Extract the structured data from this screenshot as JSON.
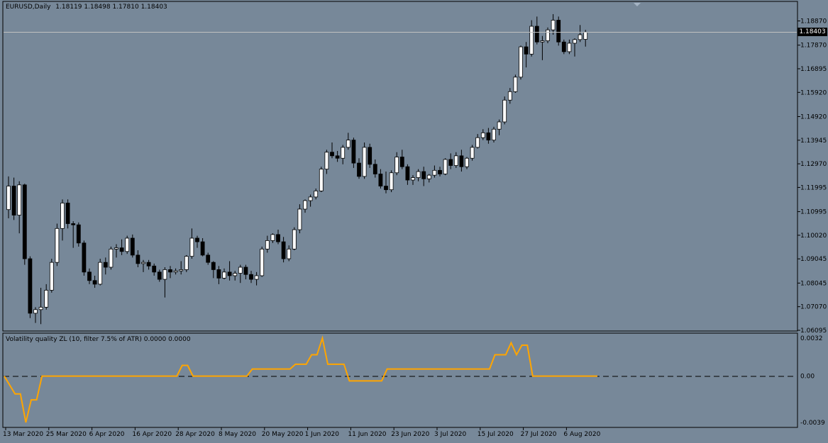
{
  "main_chart": {
    "title": "EURUSD,Daily",
    "ohlc": [
      "1.18119",
      "1.18498",
      "1.17810",
      "1.18403"
    ],
    "current_price_label": "1.18403"
  },
  "indicator": {
    "title": "Volatility quality ZL (10, filter 7.5% of ATR) 0.0000 0.0000",
    "ticks": [
      "0.0032",
      "0.00",
      "-0.0039"
    ]
  },
  "colors": {
    "background": "#778899",
    "bull_candle": "#ffffff",
    "bear_candle": "#000000",
    "indicator_line": "#ffa500",
    "current_price_line": "#c0c0c0"
  },
  "chart_data": [
    {
      "type": "candlestick",
      "title": "EURUSD,Daily",
      "x_labels": [
        "13 Mar 2020",
        "25 Mar 2020",
        "6 Apr 2020",
        "16 Apr 2020",
        "28 Apr 2020",
        "8 May 2020",
        "20 May 2020",
        "1 Jun 2020",
        "11 Jun 2020",
        "23 Jun 2020",
        "3 Jul 2020",
        "15 Jul 2020",
        "27 Jul 2020",
        "6 Aug 2020"
      ],
      "y_ticks": [
        "1.18870",
        "1.17870",
        "1.16895",
        "1.15920",
        "1.14920",
        "1.13945",
        "1.12970",
        "1.11995",
        "1.10995",
        "1.10020",
        "1.09045",
        "1.08045",
        "1.07070",
        "1.06095"
      ],
      "ylim": [
        1.06095,
        1.1952
      ],
      "current_price": 1.18403,
      "candles": [
        [
          1.1108,
          1.1245,
          1.1072,
          1.1205
        ],
        [
          1.1205,
          1.124,
          1.1065,
          1.1085
        ],
        [
          1.1085,
          1.1225,
          1.101,
          1.121
        ],
        [
          1.121,
          1.1215,
          1.088,
          1.0905
        ],
        [
          1.0905,
          1.0915,
          1.066,
          1.068
        ],
        [
          1.068,
          1.0705,
          1.064,
          1.0695
        ],
        [
          1.0695,
          1.0785,
          1.0635,
          1.0705
        ],
        [
          1.0705,
          1.08,
          1.0695,
          1.0775
        ],
        [
          1.0775,
          1.0905,
          1.0765,
          1.089
        ],
        [
          1.089,
          1.105,
          1.0875,
          1.103
        ],
        [
          1.103,
          1.115,
          1.098,
          1.1135
        ],
        [
          1.1135,
          1.115,
          1.103,
          1.105
        ],
        [
          1.105,
          1.106,
          1.095,
          1.1045
        ],
        [
          1.1045,
          1.1055,
          1.0955,
          1.097
        ],
        [
          1.097,
          1.098,
          1.0835,
          1.085
        ],
        [
          1.085,
          1.0865,
          1.08,
          1.0815
        ],
        [
          1.0815,
          1.0835,
          1.0785,
          1.08
        ],
        [
          1.08,
          1.0905,
          1.0795,
          1.089
        ],
        [
          1.089,
          1.091,
          1.084,
          1.087
        ],
        [
          1.087,
          1.0955,
          1.086,
          1.0945
        ],
        [
          1.0945,
          1.0965,
          1.091,
          1.095
        ],
        [
          1.095,
          1.0985,
          1.092,
          1.0935
        ],
        [
          1.0935,
          1.1,
          1.0925,
          1.099
        ],
        [
          1.099,
          1.1005,
          1.091,
          1.092
        ],
        [
          1.092,
          1.094,
          1.087,
          1.0885
        ],
        [
          1.0885,
          1.09,
          1.085,
          1.089
        ],
        [
          1.089,
          1.09,
          1.086,
          1.0875
        ],
        [
          1.0875,
          1.0885,
          1.0835,
          1.085
        ],
        [
          1.085,
          1.086,
          1.081,
          1.082
        ],
        [
          1.082,
          1.087,
          1.0745,
          1.086
        ],
        [
          1.086,
          1.0875,
          1.0825,
          1.085
        ],
        [
          1.085,
          1.0865,
          1.084,
          1.0855
        ],
        [
          1.0855,
          1.0895,
          1.084,
          1.086
        ],
        [
          1.086,
          1.092,
          1.085,
          1.0915
        ],
        [
          1.0915,
          1.103,
          1.0905,
          1.099
        ],
        [
          1.099,
          1.1,
          1.095,
          1.0975
        ],
        [
          1.0975,
          1.099,
          1.0915,
          1.092
        ],
        [
          1.092,
          1.093,
          1.088,
          1.089
        ],
        [
          1.089,
          1.0895,
          1.0825,
          1.086
        ],
        [
          1.086,
          1.0875,
          1.08,
          1.0825
        ],
        [
          1.0825,
          1.0865,
          1.082,
          1.085
        ],
        [
          1.085,
          1.0895,
          1.0815,
          1.0835
        ],
        [
          1.0835,
          1.0855,
          1.0815,
          1.0845
        ],
        [
          1.0845,
          1.088,
          1.0805,
          1.087
        ],
        [
          1.087,
          1.088,
          1.082,
          1.084
        ],
        [
          1.084,
          1.0855,
          1.0805,
          1.082
        ],
        [
          1.082,
          1.085,
          1.0795,
          1.0835
        ],
        [
          1.0835,
          1.0955,
          1.083,
          1.0945
        ],
        [
          1.0945,
          1.1,
          1.093,
          1.098
        ],
        [
          1.098,
          1.101,
          1.097,
          1.1005
        ],
        [
          1.1005,
          1.1025,
          1.0965,
          1.0975
        ],
        [
          1.0975,
          1.0995,
          1.089,
          1.0905
        ],
        [
          1.0905,
          1.096,
          1.0895,
          1.0945
        ],
        [
          1.0945,
          1.1035,
          1.094,
          1.1025
        ],
        [
          1.1025,
          1.113,
          1.101,
          1.111
        ],
        [
          1.111,
          1.115,
          1.1095,
          1.1145
        ],
        [
          1.1145,
          1.117,
          1.112,
          1.116
        ],
        [
          1.116,
          1.1195,
          1.115,
          1.1185
        ],
        [
          1.1185,
          1.1285,
          1.118,
          1.1275
        ],
        [
          1.1275,
          1.1355,
          1.1255,
          1.1345
        ],
        [
          1.1345,
          1.1385,
          1.132,
          1.133
        ],
        [
          1.133,
          1.135,
          1.1305,
          1.132
        ],
        [
          1.132,
          1.1375,
          1.1295,
          1.1365
        ],
        [
          1.1365,
          1.1425,
          1.1355,
          1.1395
        ],
        [
          1.1395,
          1.1405,
          1.128,
          1.13
        ],
        [
          1.13,
          1.132,
          1.1235,
          1.1245
        ],
        [
          1.1245,
          1.1385,
          1.1235,
          1.1365
        ],
        [
          1.1365,
          1.138,
          1.128,
          1.1295
        ],
        [
          1.1295,
          1.1315,
          1.124,
          1.1255
        ],
        [
          1.1255,
          1.1275,
          1.1195,
          1.1205
        ],
        [
          1.1205,
          1.1265,
          1.1175,
          1.119
        ],
        [
          1.119,
          1.127,
          1.118,
          1.126
        ],
        [
          1.126,
          1.1345,
          1.125,
          1.1325
        ],
        [
          1.1325,
          1.1355,
          1.1275,
          1.1285
        ],
        [
          1.1285,
          1.1295,
          1.121,
          1.123
        ],
        [
          1.123,
          1.125,
          1.121,
          1.124
        ],
        [
          1.124,
          1.1275,
          1.1225,
          1.1265
        ],
        [
          1.1265,
          1.1285,
          1.1205,
          1.1235
        ],
        [
          1.1235,
          1.1255,
          1.122,
          1.125
        ],
        [
          1.125,
          1.129,
          1.124,
          1.127
        ],
        [
          1.127,
          1.1285,
          1.1245,
          1.1255
        ],
        [
          1.1255,
          1.132,
          1.125,
          1.1315
        ],
        [
          1.1315,
          1.134,
          1.1275,
          1.129
        ],
        [
          1.129,
          1.1345,
          1.128,
          1.133
        ],
        [
          1.133,
          1.1355,
          1.1265,
          1.1285
        ],
        [
          1.1285,
          1.1325,
          1.1275,
          1.132
        ],
        [
          1.132,
          1.1375,
          1.131,
          1.1365
        ],
        [
          1.1365,
          1.142,
          1.136,
          1.1405
        ],
        [
          1.1405,
          1.144,
          1.1395,
          1.1425
        ],
        [
          1.1425,
          1.1445,
          1.138,
          1.1395
        ],
        [
          1.1395,
          1.145,
          1.1385,
          1.144
        ],
        [
          1.144,
          1.148,
          1.1415,
          1.147
        ],
        [
          1.147,
          1.1575,
          1.146,
          1.156
        ],
        [
          1.156,
          1.161,
          1.1545,
          1.1595
        ],
        [
          1.1595,
          1.1665,
          1.159,
          1.1655
        ],
        [
          1.1655,
          1.1785,
          1.1645,
          1.178
        ],
        [
          1.178,
          1.18,
          1.1695,
          1.175
        ],
        [
          1.175,
          1.189,
          1.174,
          1.1865
        ],
        [
          1.1865,
          1.1905,
          1.179,
          1.18
        ],
        [
          1.18,
          1.1825,
          1.1725,
          1.1805
        ],
        [
          1.1805,
          1.186,
          1.1795,
          1.185
        ],
        [
          1.185,
          1.1915,
          1.183,
          1.189
        ],
        [
          1.189,
          1.1905,
          1.1785,
          1.18
        ],
        [
          1.18,
          1.181,
          1.175,
          1.176
        ],
        [
          1.176,
          1.181,
          1.175,
          1.1795
        ],
        [
          1.1795,
          1.1815,
          1.174,
          1.181
        ],
        [
          1.181,
          1.187,
          1.18,
          1.183
        ],
        [
          1.1811,
          1.185,
          1.1781,
          1.184
        ]
      ]
    },
    {
      "type": "line",
      "title": "Volatility quality ZL (10, filter 7.5% of ATR) 0.0000 0.0000",
      "series": [
        {
          "values": [
            0.0,
            -0.0015,
            -0.0015,
            -0.0039,
            -0.002,
            -0.002,
            0.0,
            0.0,
            0.0,
            0.0,
            0.0,
            0.0,
            0.0,
            0.0,
            0.0,
            0.0,
            0.0,
            0.0,
            0.0,
            0.0,
            0.0,
            0.0,
            0.0,
            0.0,
            0.0,
            0.0,
            0.0,
            0.0,
            0.0,
            0.0,
            0.0,
            0.0,
            0.0,
            0.0,
            0.0,
            0.0,
            0.0,
            0.0,
            0.0,
            0.0,
            0.0,
            0.0,
            0.0,
            0.0,
            0.0,
            0.0,
            0.0,
            0.0,
            0.0,
            0.0,
            0.0,
            0.0,
            0.0,
            0.0,
            0.0,
            0.0,
            0.0,
            0.0,
            0.0,
            0.0,
            0.0,
            0.0,
            0.0,
            0.0,
            0.0,
            0.0,
            0.0,
            0.0,
            0.0,
            0.0,
            0.0,
            0.0,
            0.0,
            0.0,
            0.0,
            0.0,
            0.0,
            0.0,
            0.0,
            0.0,
            0.0,
            0.0,
            0.0,
            0.0,
            0.0,
            0.0,
            0.0,
            0.0,
            0.0,
            0.0,
            0.0,
            0.0,
            0.0,
            0.0,
            0.0,
            0.0,
            0.0,
            0.0,
            0.0,
            0.0,
            0.0,
            0.0,
            0.0,
            0.0,
            0.0,
            0.0,
            0.0,
            0.0,
            0.0,
            0.0,
            0.0,
            0.0
          ]
        }
      ],
      "x_values_day_index": [
        0,
        3,
        4,
        5,
        6,
        7,
        8,
        9,
        10,
        11,
        12,
        13,
        14,
        15,
        16,
        17,
        18,
        19,
        20,
        21,
        22,
        23,
        24,
        25,
        26,
        27,
        28,
        29,
        30,
        31,
        32,
        33,
        34,
        35,
        36,
        37,
        38,
        39,
        40,
        41,
        42,
        43,
        44,
        45,
        46,
        47,
        48,
        49,
        50,
        51,
        52,
        53,
        54,
        55,
        56,
        57,
        58,
        59,
        60,
        61,
        62,
        63,
        64,
        65,
        66,
        67,
        68,
        69,
        70,
        71,
        72,
        73,
        74,
        75,
        76,
        77,
        78,
        79,
        80,
        81,
        82,
        83,
        84,
        85,
        86,
        87,
        88,
        89,
        90,
        91,
        92,
        93,
        94,
        95,
        96,
        97,
        98,
        99,
        100,
        101,
        102,
        103,
        104,
        105,
        106,
        107,
        108,
        109,
        110,
        111,
        112
      ],
      "line_values": [
        0.0,
        -0.0015,
        -0.0015,
        -0.0039,
        -0.002,
        -0.002,
        0.0,
        0.0,
        0.0,
        0.0,
        0.0,
        0.0,
        0.0,
        0.0,
        0.0,
        0.0,
        0.0,
        0.0,
        0.0,
        0.0,
        0.0,
        0.0,
        0.0,
        0.0,
        0.0,
        0.0,
        0.0,
        0.0,
        0.0,
        0.0,
        0.0,
        0.0,
        0.0,
        0.0,
        0.0,
        0.0,
        0.0,
        0.0,
        0.0,
        0.0,
        0.0,
        0.0,
        0.0,
        0.0,
        0.0,
        0.0,
        0.0,
        0.0,
        0.0,
        0.0,
        0.0,
        0.0,
        0.0,
        0.0,
        0.0,
        0.0,
        0.0,
        0.0,
        0.0,
        0.0,
        0.0,
        0.0,
        0.0,
        0.0,
        0.0,
        0.0,
        0.0,
        0.0,
        0.0,
        0.0,
        0.0,
        0.0,
        0.0,
        0.0,
        0.0,
        0.0,
        0.0,
        0.0,
        0.0,
        0.0,
        0.0,
        0.0,
        0.0,
        0.0,
        0.0,
        0.0,
        0.0,
        0.0,
        0.0,
        0.0,
        0.0,
        0.0,
        0.0,
        0.0,
        0.0,
        0.0,
        0.0,
        0.0,
        0.0,
        0.0,
        0.0,
        0.0,
        0.0,
        0.0,
        0.0,
        0.0,
        0.0,
        0.0,
        0.0,
        0.0,
        0.0
      ],
      "steps": [
        [
          0,
          0.0
        ],
        [
          2,
          -0.0015
        ],
        [
          3,
          -0.0015
        ],
        [
          4,
          -0.0039
        ],
        [
          5,
          -0.002
        ],
        [
          6,
          -0.002
        ],
        [
          7,
          0.0
        ],
        [
          32,
          0.0
        ],
        [
          33,
          0.0009
        ],
        [
          34,
          0.0009
        ],
        [
          35,
          0.0
        ],
        [
          44,
          0.0
        ],
        [
          45,
          0.0
        ],
        [
          46,
          0.0006
        ],
        [
          53,
          0.0006
        ],
        [
          54,
          0.001
        ],
        [
          56,
          0.001
        ],
        [
          57,
          0.0018
        ],
        [
          58,
          0.0018
        ],
        [
          59,
          0.0032
        ],
        [
          60,
          0.001
        ],
        [
          63,
          0.001
        ],
        [
          64,
          -0.0004
        ],
        [
          70,
          -0.0004
        ],
        [
          71,
          0.0006
        ],
        [
          90,
          0.0006
        ],
        [
          91,
          0.0018
        ],
        [
          93,
          0.0018
        ],
        [
          94,
          0.0028
        ],
        [
          95,
          0.0018
        ],
        [
          96,
          0.0026
        ],
        [
          97,
          0.0026
        ],
        [
          98,
          0.0
        ],
        [
          110,
          0.0
        ]
      ],
      "y_ticks": [
        "0.0032",
        "0.00",
        "-0.0039"
      ],
      "ylim": [
        -0.0039,
        0.0032
      ]
    }
  ]
}
